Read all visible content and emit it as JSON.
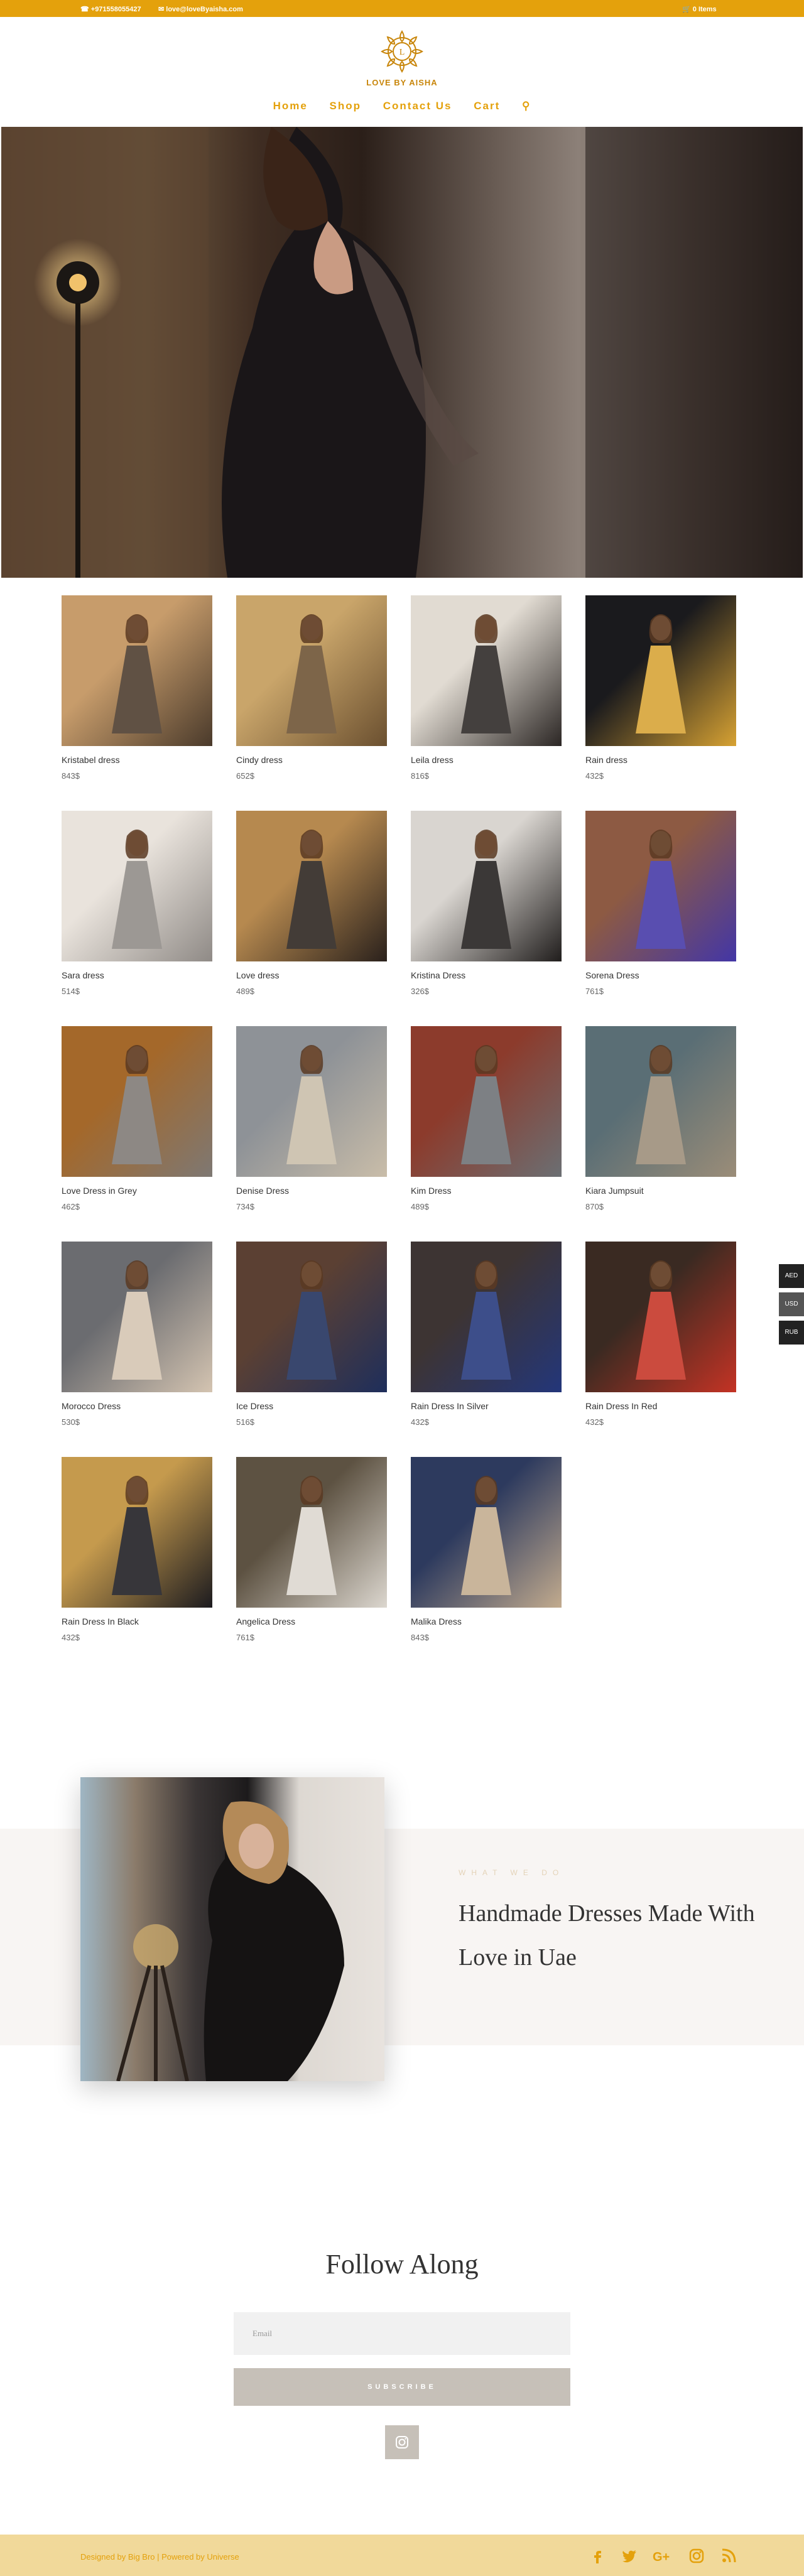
{
  "topbar": {
    "phone": "+971558055427",
    "email": "love@loveByaisha.com",
    "cart": "0 Items"
  },
  "header": {
    "brand": "LOVE BY AISHA",
    "nav": [
      "Home",
      "Shop",
      "Contact Us",
      "Cart"
    ]
  },
  "products": [
    {
      "name": "Kristabel dress",
      "price": "843$",
      "colors": [
        "#c79c6b",
        "#4a3a2b"
      ]
    },
    {
      "name": "Cindy dress",
      "price": "652$",
      "colors": [
        "#c9a56a",
        "#6b5030"
      ]
    },
    {
      "name": "Leila dress",
      "price": "816$",
      "colors": [
        "#e1dbd2",
        "#2b2624"
      ]
    },
    {
      "name": "Rain dress",
      "price": "432$",
      "colors": [
        "#1a1a1d",
        "#d7a233"
      ]
    },
    {
      "name": "Sara dress",
      "price": "514$",
      "colors": [
        "#e9e3dc",
        "#8f8a86"
      ]
    },
    {
      "name": "Love dress",
      "price": "489$",
      "colors": [
        "#b6894f",
        "#2a211c"
      ]
    },
    {
      "name": "Kristina Dress",
      "price": "326$",
      "colors": [
        "#d9d5d0",
        "#201d1c"
      ]
    },
    {
      "name": "Sorena Dress",
      "price": "761$",
      "colors": [
        "#8d5a43",
        "#4336a6"
      ]
    },
    {
      "name": "Love Dress in Grey",
      "price": "462$",
      "colors": [
        "#a4682a",
        "#7e7873"
      ]
    },
    {
      "name": "Denise Dress",
      "price": "734$",
      "colors": [
        "#8e9297",
        "#c9bda9"
      ]
    },
    {
      "name": "Kim Dress",
      "price": "489$",
      "colors": [
        "#8c3b2c",
        "#6b6f73"
      ]
    },
    {
      "name": "Kiara Jumpsuit",
      "price": "870$",
      "colors": [
        "#5a6e75",
        "#9b8d78"
      ]
    },
    {
      "name": "Morocco Dress",
      "price": "530$",
      "colors": [
        "#6b6c70",
        "#d4c4b1"
      ]
    },
    {
      "name": "Ice Dress",
      "price": "516$",
      "colors": [
        "#5b4033",
        "#1e2e5b"
      ]
    },
    {
      "name": "Rain Dress In Silver",
      "price": "432$",
      "colors": [
        "#3d3433",
        "#23367a"
      ]
    },
    {
      "name": "Rain Dress In Red",
      "price": "432$",
      "colors": [
        "#3a2a22",
        "#c43324"
      ]
    },
    {
      "name": "Rain Dress In Black",
      "price": "432$",
      "colors": [
        "#c59a4d",
        "#1c1b1f"
      ]
    },
    {
      "name": "Angelica Dress",
      "price": "761$",
      "colors": [
        "#5d5242",
        "#dcd7cf"
      ]
    },
    {
      "name": "Malika Dress",
      "price": "843$",
      "colors": [
        "#2d3a5e",
        "#c2ab8e"
      ]
    }
  ],
  "currency": [
    "AED",
    "USD",
    "RUB"
  ],
  "about": {
    "subtitle": "WHAT WE DO",
    "title": "Handmade Dresses Made With Love in Uae"
  },
  "follow": {
    "title": "Follow Along",
    "email_placeholder": "Email",
    "subscribe_label": "SUBSCRIBE"
  },
  "footer": {
    "credit": "Designed by Big Bro | Powered by Universe",
    "socials": [
      "facebook-icon",
      "twitter-icon",
      "google-plus-icon",
      "instagram-icon",
      "rss-icon"
    ]
  },
  "colors": {
    "accent": "#e4a10c",
    "footer_bg": "#f1d99a",
    "button_bg": "#c6c0b8"
  }
}
